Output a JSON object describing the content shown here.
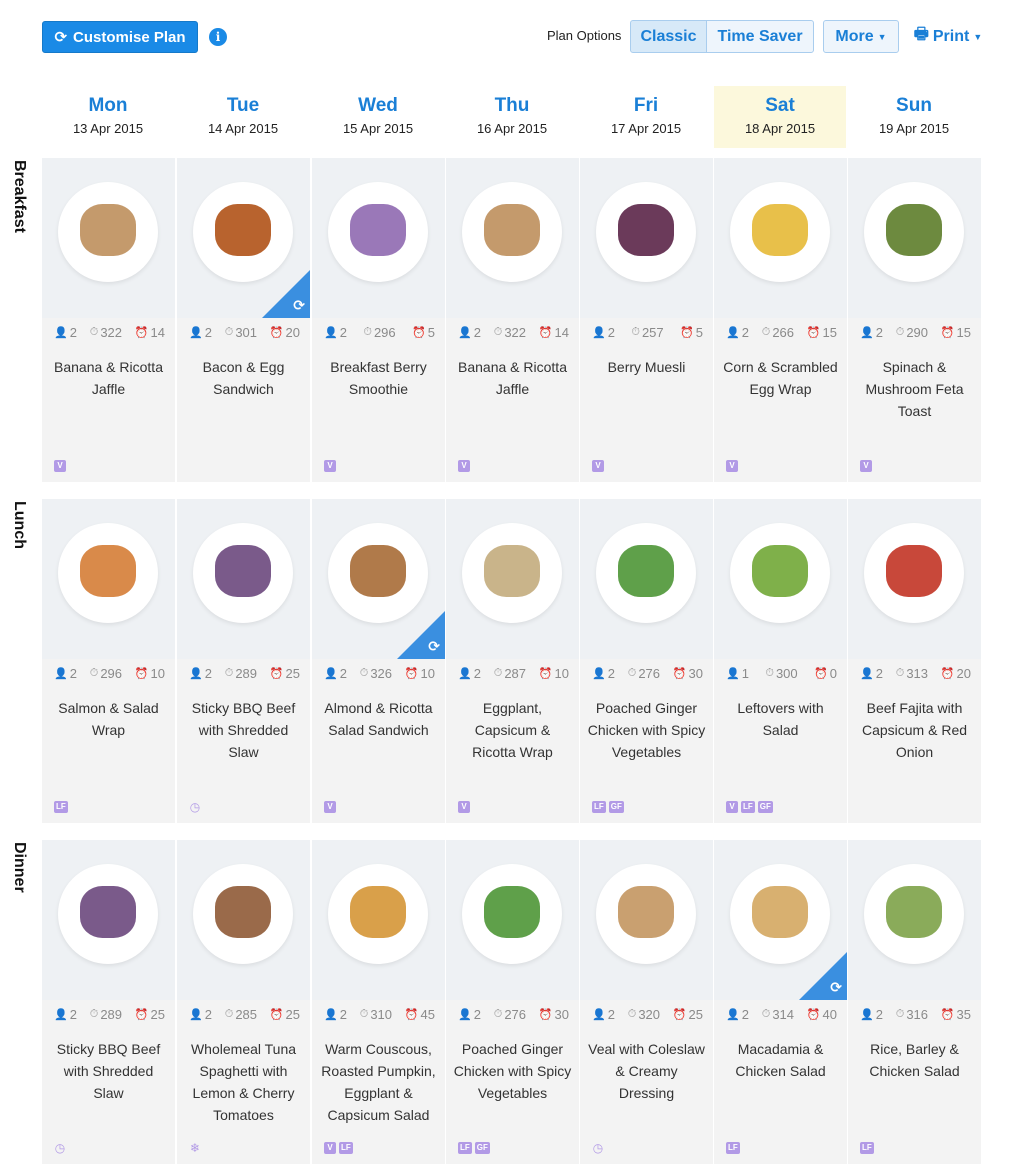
{
  "toolbar": {
    "customise_label": "Customise Plan",
    "plan_options_label": "Plan Options",
    "classic_label": "Classic",
    "time_saver_label": "Time Saver",
    "more_label": "More",
    "print_label": "Print"
  },
  "colors": {
    "accent": "#1a8ae6",
    "today_bg": "#fcf8dc",
    "tag": "#b29ae6",
    "swap": "#3a8fe0"
  },
  "days": [
    {
      "name": "Mon",
      "date": "13 Apr 2015",
      "today": false
    },
    {
      "name": "Tue",
      "date": "14 Apr 2015",
      "today": false
    },
    {
      "name": "Wed",
      "date": "15 Apr 2015",
      "today": false
    },
    {
      "name": "Thu",
      "date": "16 Apr 2015",
      "today": false
    },
    {
      "name": "Fri",
      "date": "17 Apr 2015",
      "today": false
    },
    {
      "name": "Sat",
      "date": "18 Apr 2015",
      "today": true
    },
    {
      "name": "Sun",
      "date": "19 Apr 2015",
      "today": false
    }
  ],
  "rows": [
    {
      "label": "Breakfast",
      "meals": [
        {
          "serves": "2",
          "cal": "322",
          "time": "14",
          "title": "Banana & Ricotta Jaffle",
          "tags": [
            "V"
          ],
          "swap": false,
          "food": "#c49a6c"
        },
        {
          "serves": "2",
          "cal": "301",
          "time": "20",
          "title": "Bacon & Egg Sandwich",
          "tags": [],
          "swap": true,
          "food": "#b8632e"
        },
        {
          "serves": "2",
          "cal": "296",
          "time": "5",
          "title": "Breakfast Berry Smoothie",
          "tags": [
            "V"
          ],
          "swap": false,
          "food": "#9a78b8"
        },
        {
          "serves": "2",
          "cal": "322",
          "time": "14",
          "title": "Banana & Ricotta Jaffle",
          "tags": [
            "V"
          ],
          "swap": false,
          "food": "#c49a6c"
        },
        {
          "serves": "2",
          "cal": "257",
          "time": "5",
          "title": "Berry Muesli",
          "tags": [
            "V"
          ],
          "swap": false,
          "food": "#6b3a5a"
        },
        {
          "serves": "2",
          "cal": "266",
          "time": "15",
          "title": "Corn & Scrambled Egg Wrap",
          "tags": [
            "V"
          ],
          "swap": false,
          "food": "#e8c04a"
        },
        {
          "serves": "2",
          "cal": "290",
          "time": "15",
          "title": "Spinach & Mushroom Feta Toast",
          "tags": [
            "V"
          ],
          "swap": false,
          "food": "#6d8a3f"
        }
      ]
    },
    {
      "label": "Lunch",
      "meals": [
        {
          "serves": "2",
          "cal": "296",
          "time": "10",
          "title": "Salmon & Salad Wrap",
          "tags": [
            "LF"
          ],
          "swap": false,
          "food": "#d98a4a"
        },
        {
          "serves": "2",
          "cal": "289",
          "time": "25",
          "title": "Sticky BBQ Beef with Shredded Slaw",
          "tags": [
            "clock"
          ],
          "swap": false,
          "food": "#7a5a8a"
        },
        {
          "serves": "2",
          "cal": "326",
          "time": "10",
          "title": "Almond & Ricotta Salad Sandwich",
          "tags": [
            "V"
          ],
          "swap": true,
          "food": "#b07a4a"
        },
        {
          "serves": "2",
          "cal": "287",
          "time": "10",
          "title": "Eggplant, Capsicum & Ricotta Wrap",
          "tags": [
            "V"
          ],
          "swap": false,
          "food": "#c9b48a"
        },
        {
          "serves": "2",
          "cal": "276",
          "time": "30",
          "title": "Poached Ginger Chicken with Spicy Vegetables",
          "tags": [
            "LF",
            "GF"
          ],
          "swap": false,
          "food": "#5fa04a"
        },
        {
          "serves": "1",
          "cal": "300",
          "time": "0",
          "title": "Leftovers with Salad",
          "tags": [
            "V",
            "LF",
            "GF"
          ],
          "swap": false,
          "food": "#7fb04a"
        },
        {
          "serves": "2",
          "cal": "313",
          "time": "20",
          "title": "Beef Fajita with Capsicum & Red Onion",
          "tags": [],
          "swap": false,
          "food": "#c8483a"
        }
      ]
    },
    {
      "label": "Dinner",
      "meals": [
        {
          "serves": "2",
          "cal": "289",
          "time": "25",
          "title": "Sticky BBQ Beef with Shredded Slaw",
          "tags": [
            "clock"
          ],
          "swap": false,
          "food": "#7a5a8a"
        },
        {
          "serves": "2",
          "cal": "285",
          "time": "25",
          "title": "Wholemeal Tuna Spaghetti with Lemon & Cherry Tomatoes",
          "tags": [
            "snow"
          ],
          "swap": false,
          "food": "#9a6a4a"
        },
        {
          "serves": "2",
          "cal": "310",
          "time": "45",
          "title": "Warm Couscous, Roasted Pumpkin, Eggplant & Capsicum Salad",
          "tags": [
            "V",
            "LF"
          ],
          "swap": false,
          "food": "#d9a04a"
        },
        {
          "serves": "2",
          "cal": "276",
          "time": "30",
          "title": "Poached Ginger Chicken with Spicy Vegetables",
          "tags": [
            "LF",
            "GF"
          ],
          "swap": false,
          "food": "#5fa04a"
        },
        {
          "serves": "2",
          "cal": "320",
          "time": "25",
          "title": "Veal with Coleslaw & Creamy Dressing",
          "tags": [
            "clock"
          ],
          "swap": false,
          "food": "#c9a070"
        },
        {
          "serves": "2",
          "cal": "314",
          "time": "40",
          "title": "Macadamia & Chicken Salad",
          "tags": [
            "LF"
          ],
          "swap": true,
          "food": "#d8b070"
        },
        {
          "serves": "2",
          "cal": "316",
          "time": "35",
          "title": "Rice, Barley & Chicken Salad",
          "tags": [
            "LF"
          ],
          "swap": false,
          "food": "#8aab5a"
        }
      ]
    }
  ]
}
